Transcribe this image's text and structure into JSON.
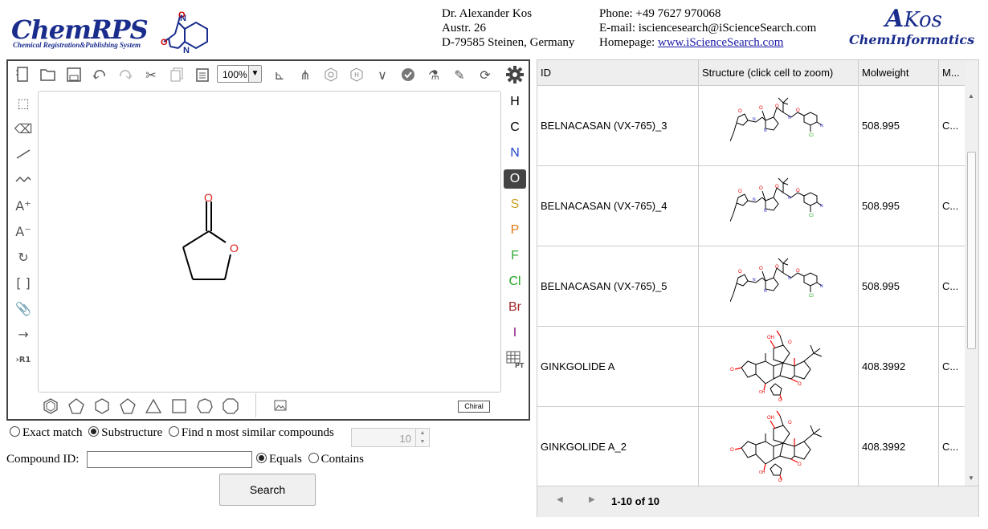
{
  "header": {
    "logo_title": "ChemRPS",
    "logo_subtitle": "Chemical Registration&Publishing System",
    "address": [
      "Dr. Alexander Kos",
      "Austr. 26",
      "D-79585 Steinen, Germany"
    ],
    "contact": {
      "phone": "Phone: +49 7627 970068",
      "email": "E-mail: isciencesearch@iScienceSearch.com",
      "homepage_label": "Homepage: ",
      "homepage_link": "www.iScienceSearch.com"
    },
    "brand_top_big": "A",
    "brand_top_rest": "Kos",
    "brand_bottom": "ChemInformatics"
  },
  "editor": {
    "zoom_value": "100%",
    "elements": [
      {
        "symbol": "H",
        "color": "#000000"
      },
      {
        "symbol": "C",
        "color": "#000000"
      },
      {
        "symbol": "N",
        "color": "#2244cc"
      },
      {
        "symbol": "O",
        "color": "#ffffff",
        "selected": true
      },
      {
        "symbol": "S",
        "color": "#c8a020"
      },
      {
        "symbol": "P",
        "color": "#e07a10"
      },
      {
        "symbol": "F",
        "color": "#33aa33"
      },
      {
        "symbol": "Cl",
        "color": "#22aa22"
      },
      {
        "symbol": "Br",
        "color": "#a52a2a"
      },
      {
        "symbol": "I",
        "color": "#8b1a8b"
      }
    ],
    "pt_label": "PT",
    "r1_label": "R1",
    "chiral_label": "Chiral",
    "molecule_atoms": {
      "oxo": "O",
      "ring_o": "O"
    }
  },
  "search": {
    "mode_exact": "Exact match",
    "mode_sub": "Substructure",
    "mode_similar": "Find n most similar compounds",
    "similar_n": "10",
    "compound_id_label": "Compound ID:",
    "compound_id_value": "",
    "equals": "Equals",
    "contains": "Contains",
    "button": "Search"
  },
  "grid": {
    "columns": [
      "ID",
      "Structure (click cell to zoom)",
      "Molweight",
      "M..."
    ],
    "rows": [
      {
        "id": "BELNACASAN (VX-765)_3",
        "mw": "508.995",
        "m": "C...",
        "structure": "belnacasan"
      },
      {
        "id": "BELNACASAN (VX-765)_4",
        "mw": "508.995",
        "m": "C...",
        "structure": "belnacasan"
      },
      {
        "id": "BELNACASAN (VX-765)_5",
        "mw": "508.995",
        "m": "C...",
        "structure": "belnacasan"
      },
      {
        "id": "GINKGOLIDE A",
        "mw": "408.3992",
        "m": "C...",
        "structure": "ginkgolide"
      },
      {
        "id": "GINKGOLIDE A_2",
        "mw": "408.3992",
        "m": "C...",
        "structure": "ginkgolide"
      }
    ],
    "pager_text": "1-10 of 10"
  }
}
